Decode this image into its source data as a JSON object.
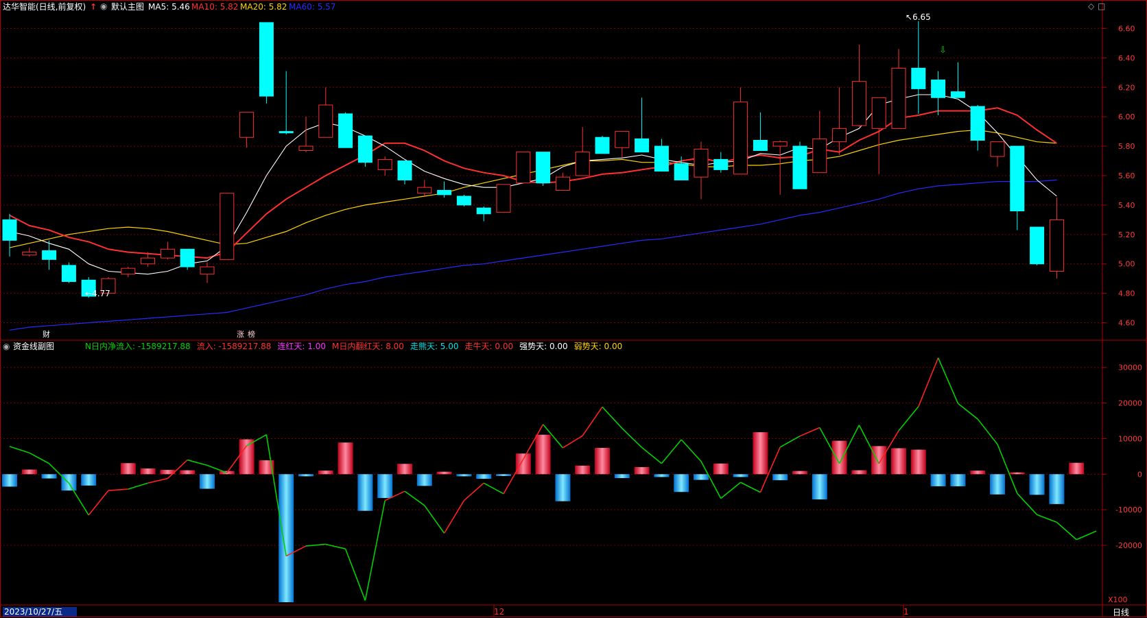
{
  "header": {
    "stock_title": "达华智能(日线,前复权)",
    "up_arrow": "↑",
    "main_chart_label": "默认主图",
    "ma5": {
      "label": "MA5:",
      "value": "5.46",
      "color": "#ffffff"
    },
    "ma10": {
      "label": "MA10:",
      "value": "5.82",
      "color": "#ff3030"
    },
    "ma20": {
      "label": "MA20:",
      "value": "5.82",
      "color": "#ffd400"
    },
    "ma60": {
      "label": "MA60:",
      "value": "5.57",
      "color": "#2a2aff"
    },
    "sub_chart_label": "资金线副图",
    "indicators": [
      {
        "label": "N日内净流入:",
        "value": "-1589217.88",
        "color": "#00d000"
      },
      {
        "label": "流入:",
        "value": "-1589217.88",
        "color": "#ff3030"
      },
      {
        "label": "连红天:",
        "value": "1.00",
        "color": "#ff30ff"
      },
      {
        "label": "M日内翻红天:",
        "value": "8.00",
        "color": "#ff3030"
      },
      {
        "label": "走熊天:",
        "value": "5.00",
        "color": "#00e0e0"
      },
      {
        "label": "走牛天:",
        "value": "0.00",
        "color": "#ff3030"
      },
      {
        "label": "强势天:",
        "value": "0.00",
        "color": "#ffffff"
      },
      {
        "label": "弱势天:",
        "value": "0.00",
        "color": "#ffd400"
      }
    ]
  },
  "annotations": {
    "high_label": "6.65",
    "low_label": "4.77",
    "cai_marker": "财",
    "zhang_marker": "涨",
    "bang_marker": "榜",
    "down_arrow": "⇩"
  },
  "bottom": {
    "date_label": "2023/10/27/五",
    "month_12": "12",
    "month_1": "1",
    "x100": "X100",
    "period_tab": "日线"
  },
  "price_axis": {
    "ticks": [
      "6.60",
      "6.40",
      "6.20",
      "6.00",
      "5.80",
      "5.60",
      "5.40",
      "5.20",
      "5.00",
      "4.80",
      "4.60"
    ]
  },
  "flow_axis": {
    "ticks": [
      "30000",
      "20000",
      "10000",
      "0",
      "-10000",
      "-20000"
    ]
  },
  "colors": {
    "up": "#ff3030",
    "down": "#00ffff",
    "grid": "#7a0000",
    "border": "#b00000",
    "green_line": "#00d000",
    "red_line": "#ff2020"
  },
  "chart_data": [
    {
      "type": "candlestick",
      "title": "达华智能(日线,前复权)",
      "ylim": [
        4.5,
        6.7
      ],
      "candles": [
        {
          "o": 5.3,
          "h": 5.34,
          "l": 5.05,
          "c": 5.16
        },
        {
          "o": 5.06,
          "h": 5.11,
          "l": 5.05,
          "c": 5.08
        },
        {
          "o": 5.09,
          "h": 5.16,
          "l": 4.96,
          "c": 5.03
        },
        {
          "o": 4.99,
          "h": 5.01,
          "l": 4.87,
          "c": 4.88
        },
        {
          "o": 4.89,
          "h": 4.91,
          "l": 4.77,
          "c": 4.78
        },
        {
          "o": 4.8,
          "h": 4.91,
          "l": 4.8,
          "c": 4.9
        },
        {
          "o": 4.93,
          "h": 4.98,
          "l": 4.91,
          "c": 4.97
        },
        {
          "o": 5.0,
          "h": 5.08,
          "l": 4.98,
          "c": 5.04
        },
        {
          "o": 5.04,
          "h": 5.15,
          "l": 5.03,
          "c": 5.1
        },
        {
          "o": 5.1,
          "h": 5.1,
          "l": 4.96,
          "c": 4.98
        },
        {
          "o": 4.93,
          "h": 5.01,
          "l": 4.87,
          "c": 4.98
        },
        {
          "o": 5.03,
          "h": 5.48,
          "l": 5.03,
          "c": 5.48
        },
        {
          "o": 5.86,
          "h": 6.03,
          "l": 5.79,
          "c": 6.03
        },
        {
          "o": 6.64,
          "h": 6.64,
          "l": 6.09,
          "c": 6.14
        },
        {
          "o": 5.9,
          "h": 6.31,
          "l": 5.88,
          "c": 5.89
        },
        {
          "o": 5.77,
          "h": 6.0,
          "l": 5.76,
          "c": 5.8
        },
        {
          "o": 5.86,
          "h": 6.2,
          "l": 5.86,
          "c": 6.08
        },
        {
          "o": 6.02,
          "h": 6.03,
          "l": 5.79,
          "c": 5.79
        },
        {
          "o": 5.87,
          "h": 5.87,
          "l": 5.66,
          "c": 5.69
        },
        {
          "o": 5.64,
          "h": 5.73,
          "l": 5.6,
          "c": 5.71
        },
        {
          "o": 5.7,
          "h": 5.7,
          "l": 5.54,
          "c": 5.57
        },
        {
          "o": 5.48,
          "h": 5.57,
          "l": 5.46,
          "c": 5.52
        },
        {
          "o": 5.5,
          "h": 5.56,
          "l": 5.45,
          "c": 5.47
        },
        {
          "o": 5.46,
          "h": 5.47,
          "l": 5.39,
          "c": 5.4
        },
        {
          "o": 5.38,
          "h": 5.39,
          "l": 5.29,
          "c": 5.34
        },
        {
          "o": 5.35,
          "h": 5.54,
          "l": 5.35,
          "c": 5.54
        },
        {
          "o": 5.55,
          "h": 5.76,
          "l": 5.55,
          "c": 5.76
        },
        {
          "o": 5.76,
          "h": 5.76,
          "l": 5.53,
          "c": 5.55
        },
        {
          "o": 5.5,
          "h": 5.62,
          "l": 5.5,
          "c": 5.59
        },
        {
          "o": 5.6,
          "h": 5.93,
          "l": 5.6,
          "c": 5.76
        },
        {
          "o": 5.86,
          "h": 5.87,
          "l": 5.76,
          "c": 5.75
        },
        {
          "o": 5.79,
          "h": 5.9,
          "l": 5.72,
          "c": 5.9
        },
        {
          "o": 5.85,
          "h": 6.13,
          "l": 5.76,
          "c": 5.76
        },
        {
          "o": 5.8,
          "h": 5.85,
          "l": 5.63,
          "c": 5.63
        },
        {
          "o": 5.68,
          "h": 5.73,
          "l": 5.59,
          "c": 5.57
        },
        {
          "o": 5.59,
          "h": 5.83,
          "l": 5.44,
          "c": 5.78
        },
        {
          "o": 5.71,
          "h": 5.76,
          "l": 5.62,
          "c": 5.64
        },
        {
          "o": 5.61,
          "h": 6.2,
          "l": 5.61,
          "c": 6.1
        },
        {
          "o": 5.84,
          "h": 6.03,
          "l": 5.79,
          "c": 5.77
        },
        {
          "o": 5.8,
          "h": 5.84,
          "l": 5.47,
          "c": 5.83
        },
        {
          "o": 5.8,
          "h": 5.83,
          "l": 5.51,
          "c": 5.51
        },
        {
          "o": 5.62,
          "h": 6.04,
          "l": 5.62,
          "c": 5.85
        },
        {
          "o": 5.83,
          "h": 6.2,
          "l": 5.74,
          "c": 5.92
        },
        {
          "o": 5.94,
          "h": 6.49,
          "l": 5.93,
          "c": 6.24
        },
        {
          "o": 5.92,
          "h": 6.08,
          "l": 5.61,
          "c": 6.13
        },
        {
          "o": 5.92,
          "h": 6.46,
          "l": 5.93,
          "c": 6.33
        },
        {
          "o": 6.33,
          "h": 6.65,
          "l": 6.02,
          "c": 6.19
        },
        {
          "o": 6.25,
          "h": 6.31,
          "l": 6.01,
          "c": 6.13
        },
        {
          "o": 6.17,
          "h": 6.37,
          "l": 6.14,
          "c": 6.13
        },
        {
          "o": 6.07,
          "h": 6.08,
          "l": 5.77,
          "c": 5.84
        },
        {
          "o": 5.73,
          "h": 5.83,
          "l": 5.66,
          "c": 5.83
        },
        {
          "o": 5.8,
          "h": 5.8,
          "l": 5.23,
          "c": 5.36
        },
        {
          "o": 5.25,
          "h": 5.25,
          "l": 4.99,
          "c": 5.0
        },
        {
          "o": 4.95,
          "h": 5.45,
          "l": 4.9,
          "c": 5.3
        }
      ],
      "ma5": [
        5.22,
        5.19,
        5.14,
        5.1,
        5.0,
        4.95,
        4.94,
        4.93,
        4.95,
        5.0,
        5.02,
        5.12,
        5.35,
        5.6,
        5.8,
        5.91,
        5.96,
        5.93,
        5.87,
        5.8,
        5.71,
        5.63,
        5.58,
        5.54,
        5.52,
        5.52,
        5.55,
        5.58,
        5.66,
        5.7,
        5.71,
        5.72,
        5.74,
        5.71,
        5.69,
        5.67,
        5.69,
        5.7,
        5.75,
        5.74,
        5.79,
        5.78,
        5.86,
        5.92,
        6.08,
        6.12,
        6.15,
        6.15,
        6.12,
        6.03,
        5.89,
        5.73,
        5.57,
        5.46
      ],
      "ma10": [
        5.33,
        5.26,
        5.23,
        5.18,
        5.15,
        5.1,
        5.08,
        5.07,
        5.06,
        5.05,
        5.04,
        5.08,
        5.21,
        5.34,
        5.44,
        5.52,
        5.6,
        5.67,
        5.74,
        5.82,
        5.82,
        5.77,
        5.7,
        5.65,
        5.62,
        5.6,
        5.56,
        5.55,
        5.56,
        5.58,
        5.61,
        5.62,
        5.64,
        5.66,
        5.7,
        5.72,
        5.69,
        5.72,
        5.74,
        5.72,
        5.73,
        5.78,
        5.76,
        5.84,
        5.9,
        5.99,
        6.01,
        6.04,
        6.04,
        6.04,
        6.06,
        6.01,
        5.91,
        5.82
      ],
      "ma20": [
        5.11,
        5.14,
        5.17,
        5.2,
        5.22,
        5.24,
        5.25,
        5.24,
        5.22,
        5.19,
        5.16,
        5.13,
        5.14,
        5.18,
        5.22,
        5.28,
        5.33,
        5.37,
        5.4,
        5.42,
        5.44,
        5.46,
        5.48,
        5.52,
        5.55,
        5.58,
        5.61,
        5.64,
        5.67,
        5.7,
        5.7,
        5.71,
        5.69,
        5.69,
        5.68,
        5.66,
        5.66,
        5.67,
        5.67,
        5.68,
        5.7,
        5.71,
        5.73,
        5.77,
        5.81,
        5.84,
        5.86,
        5.88,
        5.9,
        5.91,
        5.89,
        5.86,
        5.83,
        5.82
      ],
      "ma60": [
        4.55,
        4.57,
        4.58,
        4.59,
        4.6,
        4.61,
        4.62,
        4.63,
        4.64,
        4.65,
        4.66,
        4.67,
        4.7,
        4.73,
        4.76,
        4.79,
        4.83,
        4.86,
        4.88,
        4.91,
        4.93,
        4.95,
        4.97,
        4.99,
        5.0,
        5.02,
        5.04,
        5.06,
        5.08,
        5.1,
        5.12,
        5.14,
        5.16,
        5.17,
        5.19,
        5.21,
        5.23,
        5.25,
        5.27,
        5.3,
        5.33,
        5.35,
        5.38,
        5.41,
        5.44,
        5.48,
        5.51,
        5.53,
        5.54,
        5.55,
        5.56,
        5.56,
        5.56,
        5.57
      ]
    },
    {
      "type": "bar",
      "title": "资金线副图",
      "ylim": [
        -36000,
        34000
      ],
      "bars": [
        -3500,
        1300,
        -1200,
        -4600,
        -3200,
        0,
        3100,
        1600,
        1200,
        1100,
        -4100,
        900,
        9800,
        3900,
        -36000,
        -600,
        1000,
        8900,
        -10300,
        -6700,
        2900,
        -3300,
        700,
        -600,
        -1300,
        -500,
        5800,
        11100,
        -7600,
        2400,
        7400,
        -1100,
        2000,
        -800,
        -5000,
        -1600,
        3000,
        -800,
        11800,
        -1700,
        900,
        -7100,
        9400,
        1100,
        7900,
        7300,
        6900,
        -3400,
        -3400,
        1000,
        -5700,
        500,
        -5800,
        -8400,
        3200
      ],
      "green_line": [
        7800,
        6000,
        3000,
        -2500,
        -11500,
        -4600,
        -4200,
        -2500,
        -1200,
        4000,
        2500,
        400,
        8000,
        11100,
        -23000,
        -20200,
        -19700,
        -21000,
        -35500,
        -7400,
        -4800,
        -8800,
        -16600,
        -7400,
        -2500,
        -5500,
        4200,
        14000,
        7400,
        10800,
        18900,
        12900,
        7500,
        3000,
        9700,
        3600,
        -6800,
        -2300,
        -5100,
        7600,
        10700,
        13100,
        3000,
        13800,
        3000,
        12200,
        19000,
        32700,
        19900,
        15500,
        8400,
        -5400,
        -11400,
        -13500,
        -18400,
        -16000
      ]
    }
  ]
}
